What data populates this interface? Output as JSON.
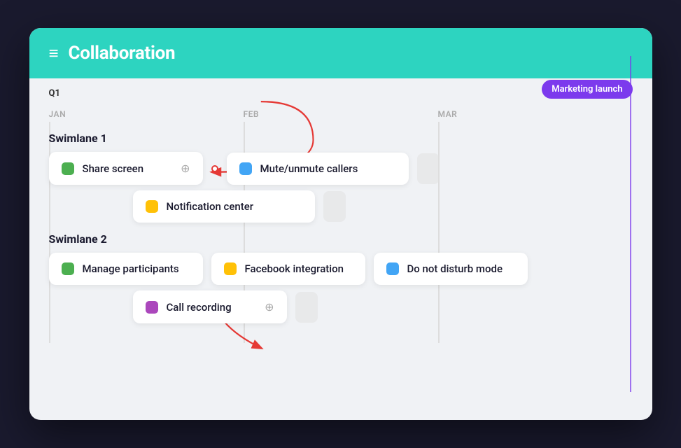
{
  "header": {
    "title": "Collaboration",
    "icon": "≡"
  },
  "timeline": {
    "quarter": "Q1",
    "months": [
      "JAN",
      "FEB",
      "MAR"
    ],
    "milestone": "Marketing launch"
  },
  "swimlanes": [
    {
      "id": "swimlane-1",
      "label": "Swimlane 1",
      "rows": [
        {
          "cards": [
            {
              "id": "share-screen",
              "label": "Share screen",
              "color": "green",
              "hasLinkIcon": true,
              "hasConnectDot": true
            },
            {
              "id": "mute-callers",
              "label": "Mute/unmute callers",
              "color": "blue",
              "hasLinkIcon": false,
              "hasConnectDot": false
            }
          ],
          "hasPlaceholder": true
        },
        {
          "offset": true,
          "cards": [
            {
              "id": "notification-center",
              "label": "Notification center",
              "color": "yellow",
              "hasLinkIcon": false,
              "hasConnectDot": false
            }
          ],
          "hasPlaceholder": true
        }
      ]
    },
    {
      "id": "swimlane-2",
      "label": "Swimlane 2",
      "rows": [
        {
          "cards": [
            {
              "id": "manage-participants",
              "label": "Manage participants",
              "color": "green",
              "hasLinkIcon": false,
              "hasConnectDot": false
            },
            {
              "id": "facebook-integration",
              "label": "Facebook integration",
              "color": "yellow",
              "hasLinkIcon": false,
              "hasConnectDot": false
            },
            {
              "id": "do-not-disturb",
              "label": "Do not disturb mode",
              "color": "blue",
              "hasLinkIcon": false,
              "hasConnectDot": false
            }
          ],
          "hasPlaceholder": false
        },
        {
          "offset": true,
          "cards": [
            {
              "id": "call-recording",
              "label": "Call recording",
              "color": "purple",
              "hasLinkIcon": true,
              "hasConnectDot": false
            }
          ],
          "hasPlaceholder": true
        }
      ]
    }
  ]
}
